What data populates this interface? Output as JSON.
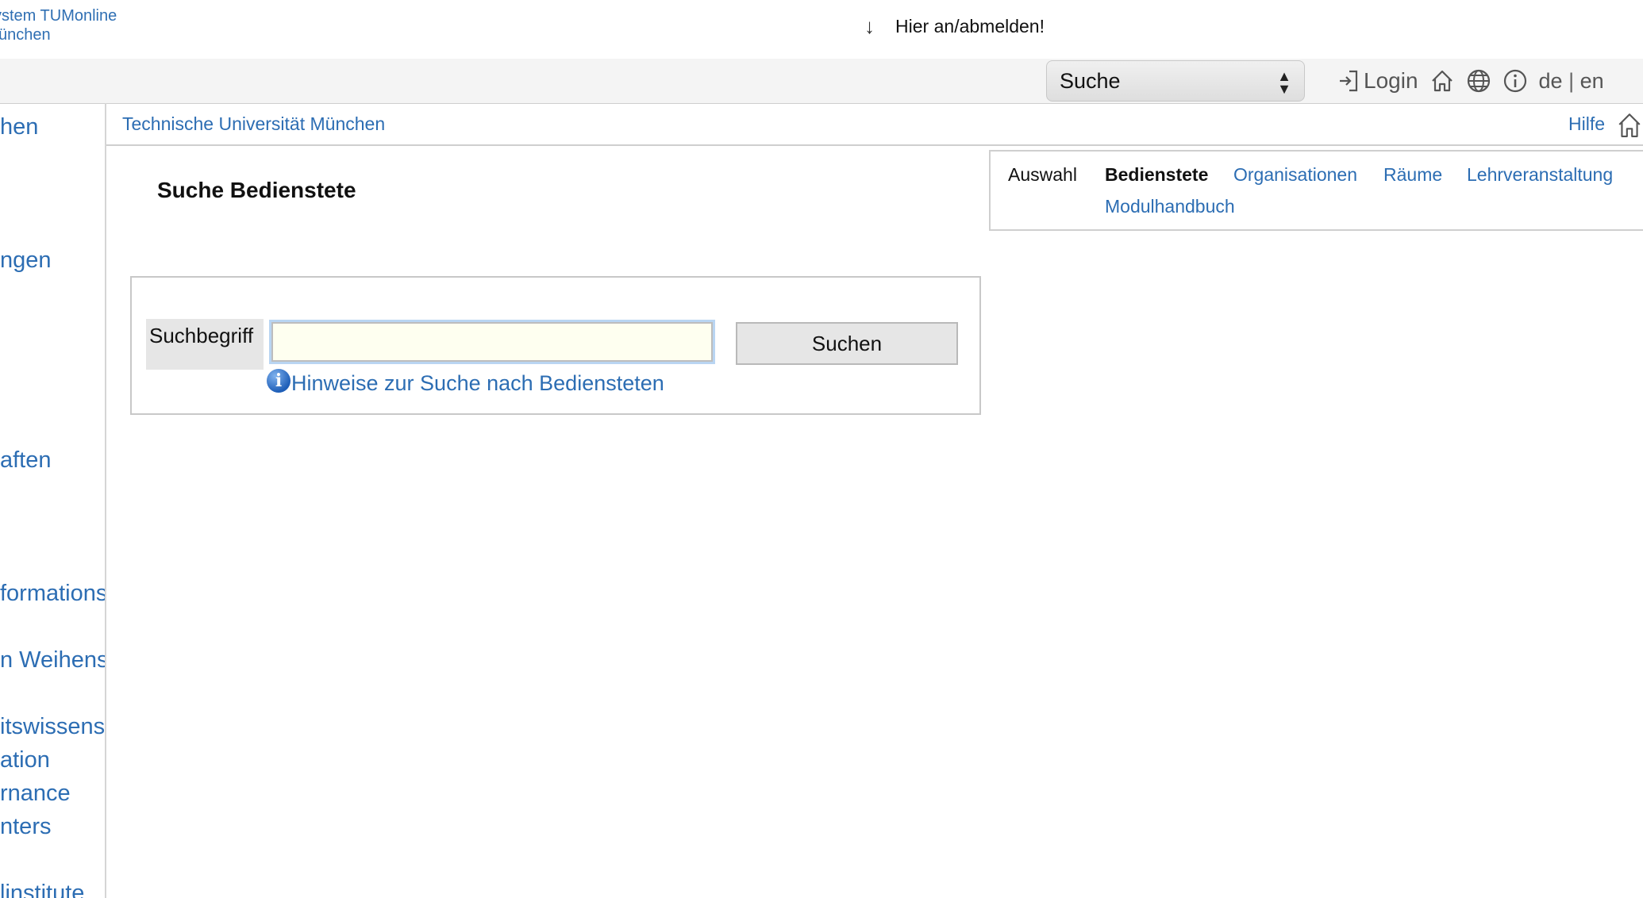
{
  "header": {
    "logo_line1": "ystem TUMonline",
    "logo_line2": "ünchen",
    "login_hint": "Hier an/abmelden!"
  },
  "utility_bar": {
    "search_select": "Suche",
    "login_label": "Login",
    "lang_de": "de",
    "lang_separator": "|",
    "lang_en": "en",
    "icons": [
      "login-icon",
      "home-icon",
      "globe-icon",
      "info-icon"
    ]
  },
  "sidebar": {
    "items": [
      "hen",
      "ngen",
      "aften",
      "formations",
      "n Weihens",
      "itswissens",
      "ation",
      "rnance",
      "nters",
      "linstitute"
    ]
  },
  "breadcrumb": {
    "organization": "Technische Universität München",
    "help": "Hilfe"
  },
  "page": {
    "title": "Suche Bedienstete"
  },
  "tabs": {
    "auswahl": "Auswahl",
    "bedienstete": "Bedienstete",
    "organisationen": "Organisationen",
    "raeume": "Räume",
    "lehrveranstaltung": "Lehrveranstaltung",
    "modulhandbuch": "Modulhandbuch"
  },
  "search_form": {
    "label": "Suchbegriff",
    "input_value": "",
    "button_label": "Suchen",
    "hint_link": "Hinweise zur Suche nach Bediensteten"
  },
  "colors": {
    "link": "#2c6db3",
    "input_background": "#fefff0",
    "focus_ring": "#b9d5f2"
  }
}
